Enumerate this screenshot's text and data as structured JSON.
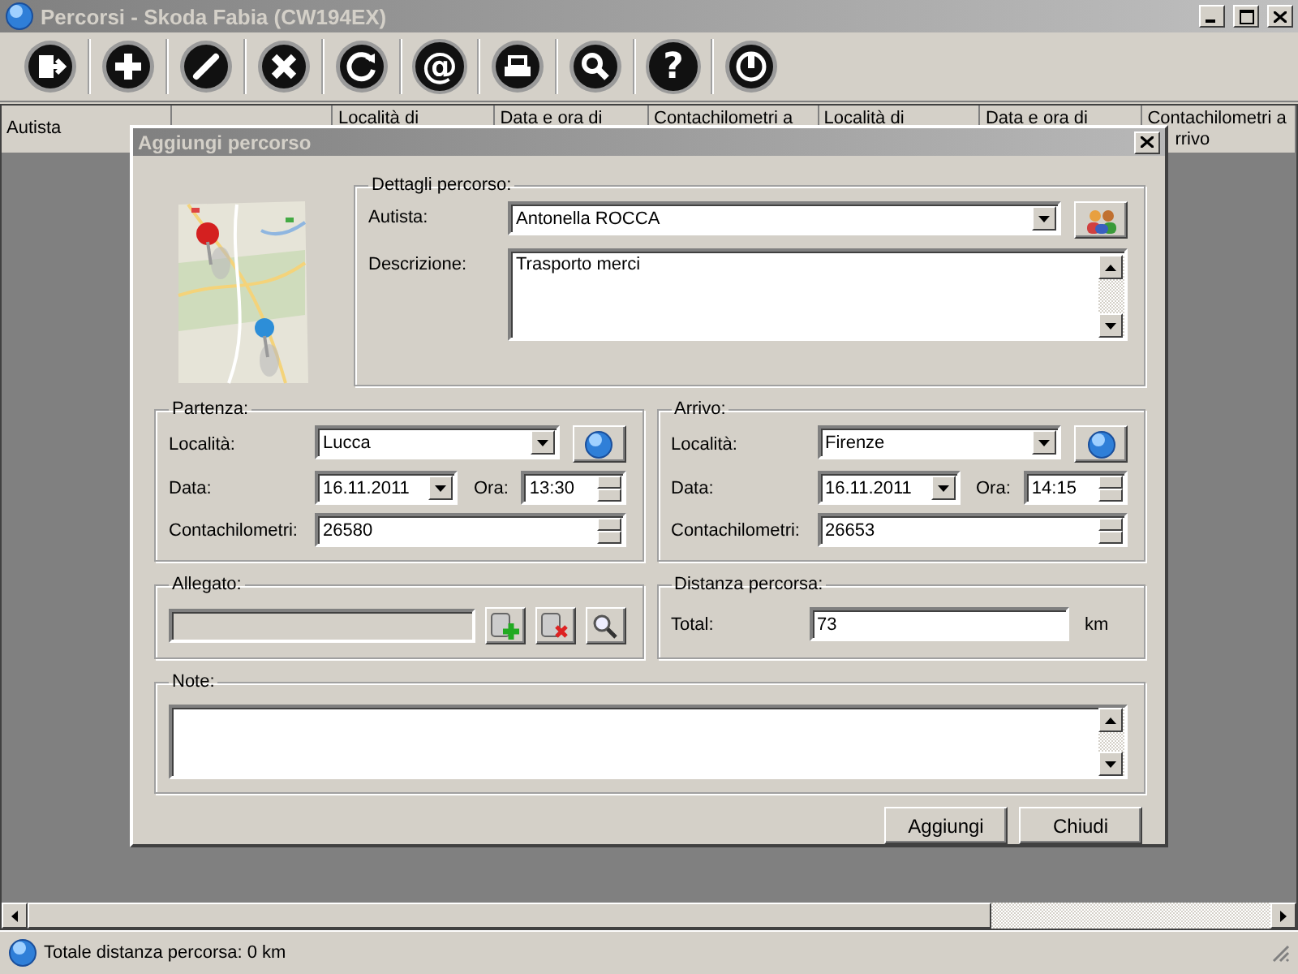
{
  "window": {
    "title": "Percorsi - Skoda Fabia (CW194EX)"
  },
  "toolbar": [
    {
      "kind": "exit"
    },
    {
      "kind": "add"
    },
    {
      "kind": "edit"
    },
    {
      "kind": "delete"
    },
    {
      "kind": "refresh"
    },
    {
      "kind": "glyph",
      "glyph": "@"
    },
    {
      "kind": "print"
    },
    {
      "kind": "search"
    },
    {
      "kind": "glyph",
      "glyph": "?"
    },
    {
      "kind": "power"
    }
  ],
  "table": {
    "columns": [
      {
        "lines": [
          "Autista"
        ]
      },
      {},
      {
        "lines": [
          "Località di"
        ]
      },
      {
        "lines": [
          "Data e ora di"
        ]
      },
      {
        "lines": [
          "Contachilometri a"
        ]
      },
      {
        "lines": [
          "Località di"
        ]
      },
      {
        "lines": [
          "Data e ora di"
        ]
      },
      {
        "lines": [
          "Contachilometri a",
          "rrivo"
        ]
      }
    ]
  },
  "dialog": {
    "title": "Aggiungi percorso",
    "details": {
      "legend": "Dettagli percorso:",
      "driver_label": "Autista:",
      "driver": "Antonella ROCCA",
      "description_label": "Descrizione:",
      "description": "Trasporto merci"
    },
    "departure": {
      "legend": "Partenza:",
      "place_label": "Località:",
      "place": "Lucca",
      "date_label": "Data:",
      "date": "16.11.2011",
      "time_label": "Ora:",
      "time": "13:30",
      "odometer_label": "Contachilometri:",
      "odometer": "26580"
    },
    "arrival": {
      "legend": "Arrivo:",
      "place_label": "Località:",
      "place": "Firenze",
      "date_label": "Data:",
      "date": "16.11.2011",
      "time_label": "Ora:",
      "time": "14:15",
      "odometer_label": "Contachilometri:",
      "odometer": "26653"
    },
    "attachment": {
      "legend": "Allegato:"
    },
    "distance": {
      "legend": "Distanza percorsa:",
      "label": "Total:",
      "value": "73",
      "unit": "km"
    },
    "notes": {
      "legend": "Note:"
    },
    "buttons": [
      "Aggiungi",
      "Chiudi"
    ]
  },
  "status_bar": {
    "text": "Totale distanza percorsa: 0 km"
  }
}
